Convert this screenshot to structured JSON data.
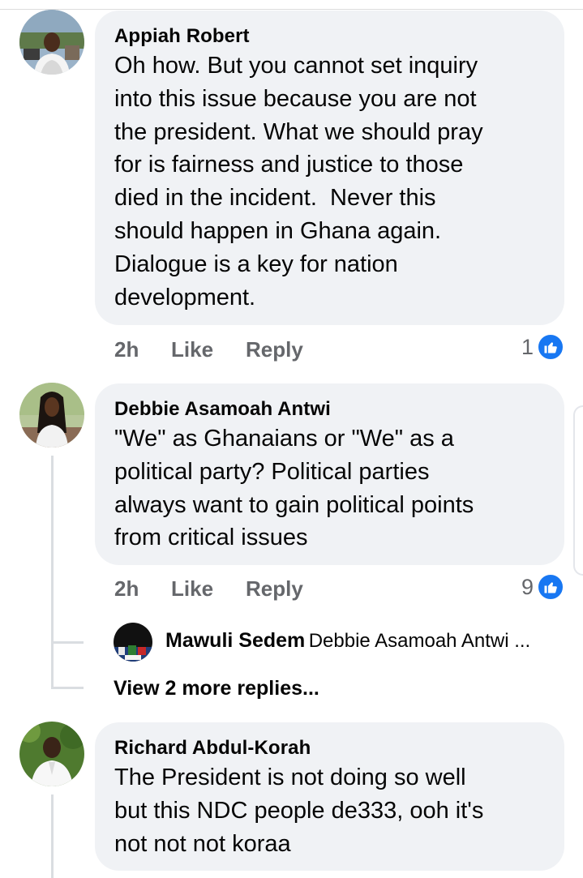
{
  "comments": [
    {
      "author": "Appiah Robert",
      "text": "Oh how. But you cannot set inquiry\ninto this issue because you are not\nthe president. What we should pray\nfor is fairness and justice to those\ndied in the incident.  Never this\nshould happen in Ghana again.\nDialogue is a key for nation\ndevelopment.",
      "time": "2h",
      "like_label": "Like",
      "reply_label": "Reply",
      "reaction_count": "1",
      "reaction_icon": "like-icon"
    },
    {
      "author": "Debbie Asamoah Antwi",
      "text": "\"We\" as Ghanaians or \"We\" as a\npolitical party? Political parties\nalways want to gain political points\nfrom critical issues",
      "time": "2h",
      "like_label": "Like",
      "reply_label": "Reply",
      "reaction_count": "9",
      "reaction_icon": "like-icon",
      "reply_preview": {
        "author": "Mawuli Sedem",
        "text": "Debbie Asamoah Antwi ..."
      },
      "view_more_label": "View 2 more replies..."
    },
    {
      "author": "Richard Abdul-Korah",
      "text": "The President is not doing so well\nbut this NDC people de333, ooh it's\nnot not not koraa"
    }
  ],
  "colors": {
    "bubble": "#f0f2f5",
    "secondary_text": "#65676b",
    "like_blue": "#1877f2",
    "thread_line": "#dadde1"
  }
}
